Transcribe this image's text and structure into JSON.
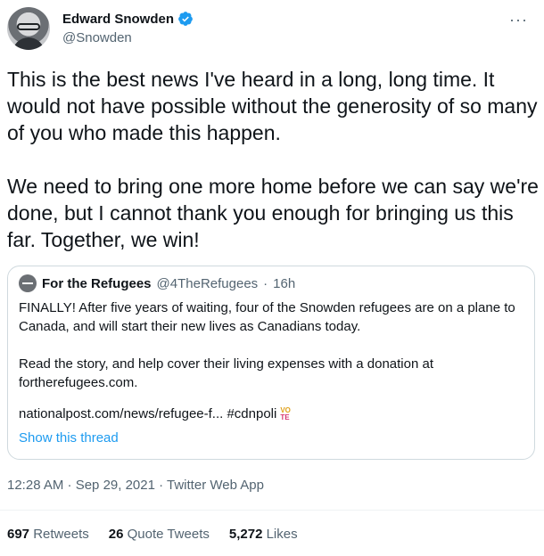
{
  "author": {
    "name": "Edward Snowden",
    "handle": "@Snowden",
    "verified": true
  },
  "more_icon": "more-options-icon",
  "tweet": {
    "text": "This is the best news I've heard in a long, long time. It would not have possible without the generosity of so many of you who made this happen.\n\nWe need to bring one more home before we can say we're done, but I cannot thank you enough for bringing us this far. Together, we win!"
  },
  "quoted": {
    "name": "For the Refugees",
    "handle": "@4TheRefugees",
    "separator": "·",
    "time": "16h",
    "text": "FINALLY! After five years of waiting, four of the Snowden refugees are on a plane to Canada, and will start their new lives as Canadians today.\n\nRead the story, and help cover their living expenses with a donation at fortherefugees.com.",
    "link": "nationalpost.com/news/refugee-f... #cdnpoli",
    "vote_icon": {
      "line1": "VO",
      "line2": "TE"
    },
    "show_thread": "Show this thread"
  },
  "meta": {
    "timestamp": "12:28 AM · Sep 29, 2021 · Twitter Web App"
  },
  "stats": {
    "retweets": {
      "count": "697",
      "label": "Retweets"
    },
    "quotes": {
      "count": "26",
      "label": "Quote Tweets"
    },
    "likes": {
      "count": "5,272",
      "label": "Likes"
    }
  },
  "colors": {
    "verified": "#1d9bf0",
    "link": "#1d9bf0",
    "muted": "#536471"
  }
}
